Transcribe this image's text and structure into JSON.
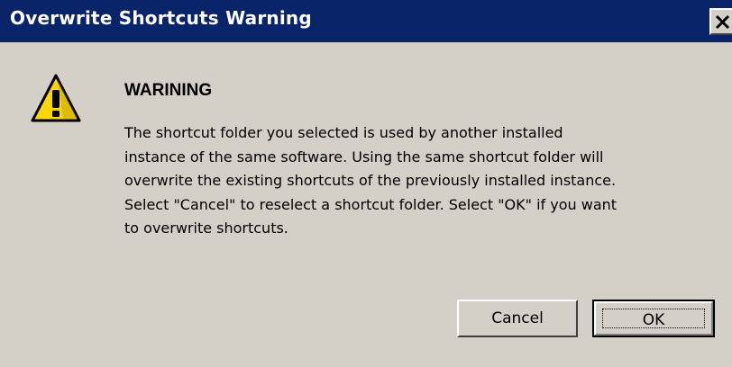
{
  "window": {
    "title": "Overwrite Shortcuts Warning",
    "close_label": "×"
  },
  "icon": "warning-icon",
  "heading": "WARINING",
  "message_lines": [
    "The shortcut folder you selected is used by another installed",
    "instance of the same software. Using the same shortcut folder will",
    "overwrite the existing shortcuts of the previously installed instance.",
    "Select \"Cancel\" to reselect a shortcut folder. Select \"OK\" if you want",
    "to overwrite shortcuts."
  ],
  "buttons": {
    "cancel_label": "Cancel",
    "ok_label": "OK"
  },
  "colors": {
    "titlebar": "#0a246a",
    "dialog_bg": "#d4d0c8",
    "warning_yellow": "#ffd700"
  }
}
